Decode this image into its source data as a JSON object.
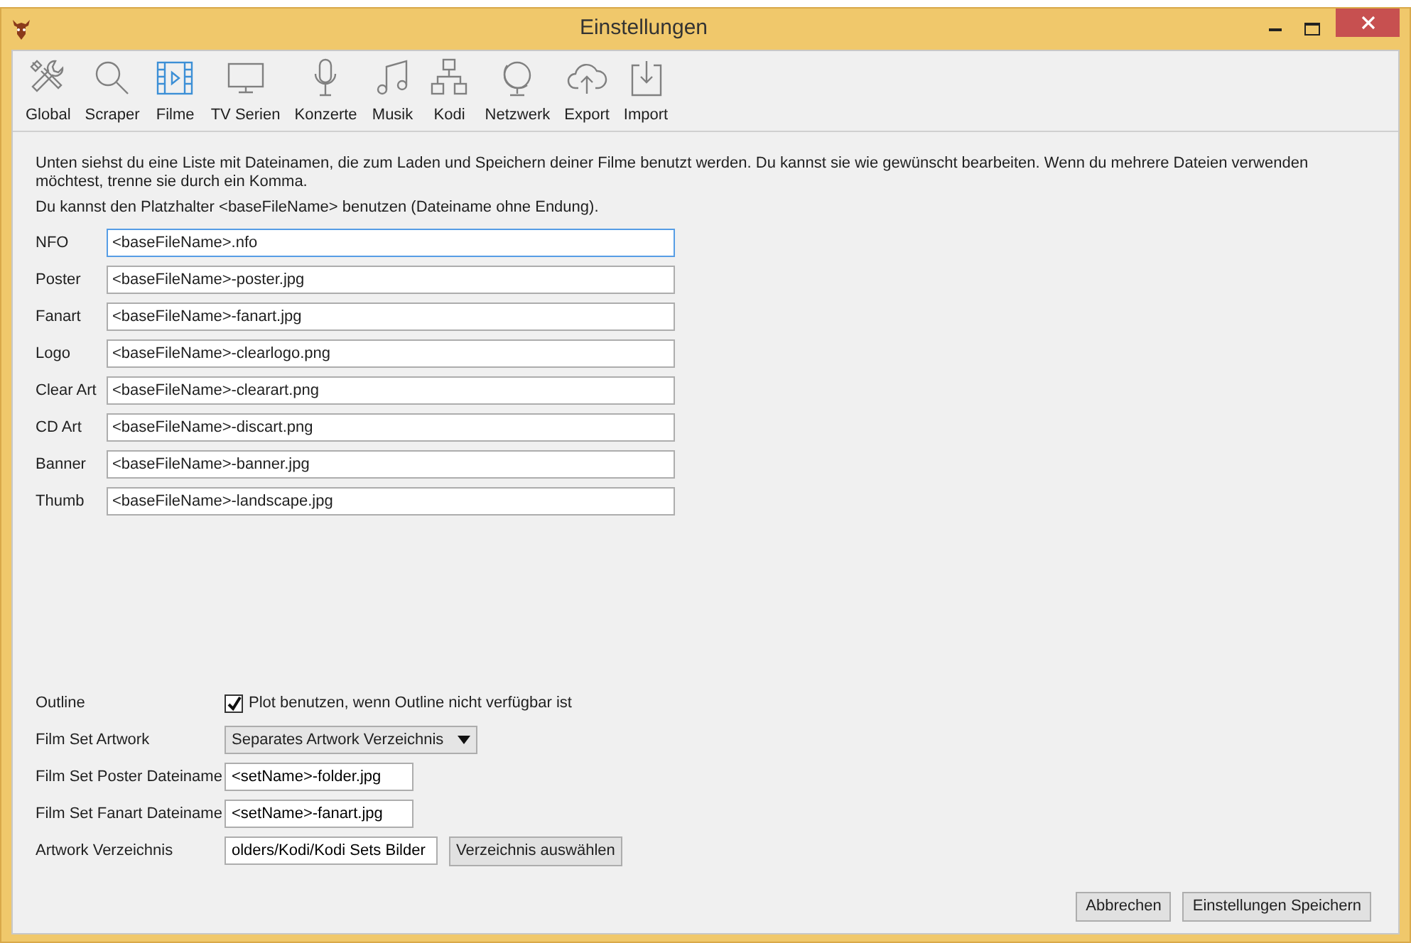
{
  "window": {
    "title": "Einstellungen"
  },
  "tabs": [
    {
      "label": "Global",
      "selected": false
    },
    {
      "label": "Scraper",
      "selected": false
    },
    {
      "label": "Filme",
      "selected": true
    },
    {
      "label": "TV Serien",
      "selected": false
    },
    {
      "label": "Konzerte",
      "selected": false
    },
    {
      "label": "Musik",
      "selected": false
    },
    {
      "label": "Kodi",
      "selected": false
    },
    {
      "label": "Netzwerk",
      "selected": false
    },
    {
      "label": "Export",
      "selected": false
    },
    {
      "label": "Import",
      "selected": false
    }
  ],
  "intro": [
    "Unten siehst du eine Liste mit Dateinamen, die zum Laden und Speichern deiner Filme benutzt werden. Du kannst sie wie gewünscht bearbeiten. Wenn du mehrere Dateien verwenden möchtest, trenne sie durch ein Komma.",
    "Du kannst den Platzhalter <baseFileName> benutzen (Dateiname ohne Endung)."
  ],
  "filenames": [
    {
      "label": "NFO",
      "value": "<baseFileName>.nfo",
      "focused": true
    },
    {
      "label": "Poster",
      "value": "<baseFileName>-poster.jpg",
      "focused": false
    },
    {
      "label": "Fanart",
      "value": "<baseFileName>-fanart.jpg",
      "focused": false
    },
    {
      "label": "Logo",
      "value": "<baseFileName>-clearlogo.png",
      "focused": false
    },
    {
      "label": "Clear Art",
      "value": "<baseFileName>-clearart.png",
      "focused": false
    },
    {
      "label": "CD Art",
      "value": "<baseFileName>-discart.png",
      "focused": false
    },
    {
      "label": "Banner",
      "value": "<baseFileName>-banner.jpg",
      "focused": false
    },
    {
      "label": "Thumb",
      "value": "<baseFileName>-landscape.jpg",
      "focused": false
    }
  ],
  "options": [
    {
      "kind": "checkbox",
      "label": "Outline",
      "text": "Plot benutzen, wenn Outline nicht verfügbar ist",
      "checked": true
    },
    {
      "kind": "dropdown",
      "label": "Film Set Artwork",
      "value": "Separates Artwork Verzeichnis"
    },
    {
      "kind": "text",
      "label": "Film Set Poster Dateiname",
      "value": "<setName>-folder.jpg"
    },
    {
      "kind": "text",
      "label": "Film Set Fanart Dateiname",
      "value": "<setName>-fanart.jpg"
    },
    {
      "kind": "path",
      "label": "Artwork Verzeichnis",
      "value": "olders/Kodi/Kodi Sets Bilder",
      "button": "Verzeichnis auswählen"
    }
  ],
  "buttons": [
    "Abbrechen",
    "Einstellungen Speichern"
  ]
}
